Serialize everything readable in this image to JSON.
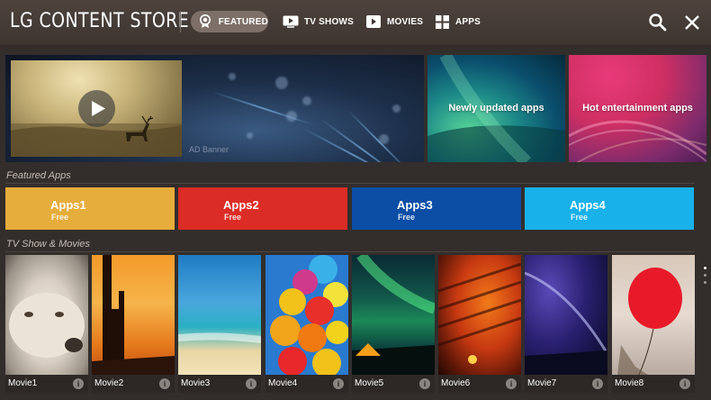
{
  "header": {
    "logo": "LG CONTENT STORE",
    "tabs": [
      {
        "label": "FEATURED",
        "icon": "featured-badge-icon",
        "selected": true
      },
      {
        "label": "TV SHOWS",
        "icon": "tv-play-icon",
        "selected": false
      },
      {
        "label": "MOVIES",
        "icon": "movie-play-icon",
        "selected": false
      },
      {
        "label": "APPS",
        "icon": "apps-grid-icon",
        "selected": false
      }
    ],
    "search_icon": "search-icon",
    "close_icon": "close-icon"
  },
  "banners": {
    "main": {
      "label": "AD Banner"
    },
    "side": [
      {
        "label": "Newly updated apps"
      },
      {
        "label": "Hot entertainment apps"
      }
    ]
  },
  "featured_apps": {
    "title": "Featured Apps",
    "items": [
      {
        "name": "Apps1",
        "price": "Free",
        "color": "#e6ad3c"
      },
      {
        "name": "Apps2",
        "price": "Free",
        "color": "#dc2c26"
      },
      {
        "name": "Apps3",
        "price": "Free",
        "color": "#0c4ea6"
      },
      {
        "name": "Apps4",
        "price": "Free",
        "color": "#18b1e9"
      }
    ]
  },
  "tv_movies": {
    "title": "TV Show & Movies",
    "items": [
      {
        "name": "Movie1",
        "info": "i"
      },
      {
        "name": "Movie2",
        "info": "i"
      },
      {
        "name": "Movie3",
        "info": "i"
      },
      {
        "name": "Movie4",
        "info": "i"
      },
      {
        "name": "Movie5",
        "info": "i"
      },
      {
        "name": "Movie6",
        "info": "i"
      },
      {
        "name": "Movie7",
        "info": "i"
      },
      {
        "name": "Movie8",
        "info": "i"
      }
    ]
  }
}
